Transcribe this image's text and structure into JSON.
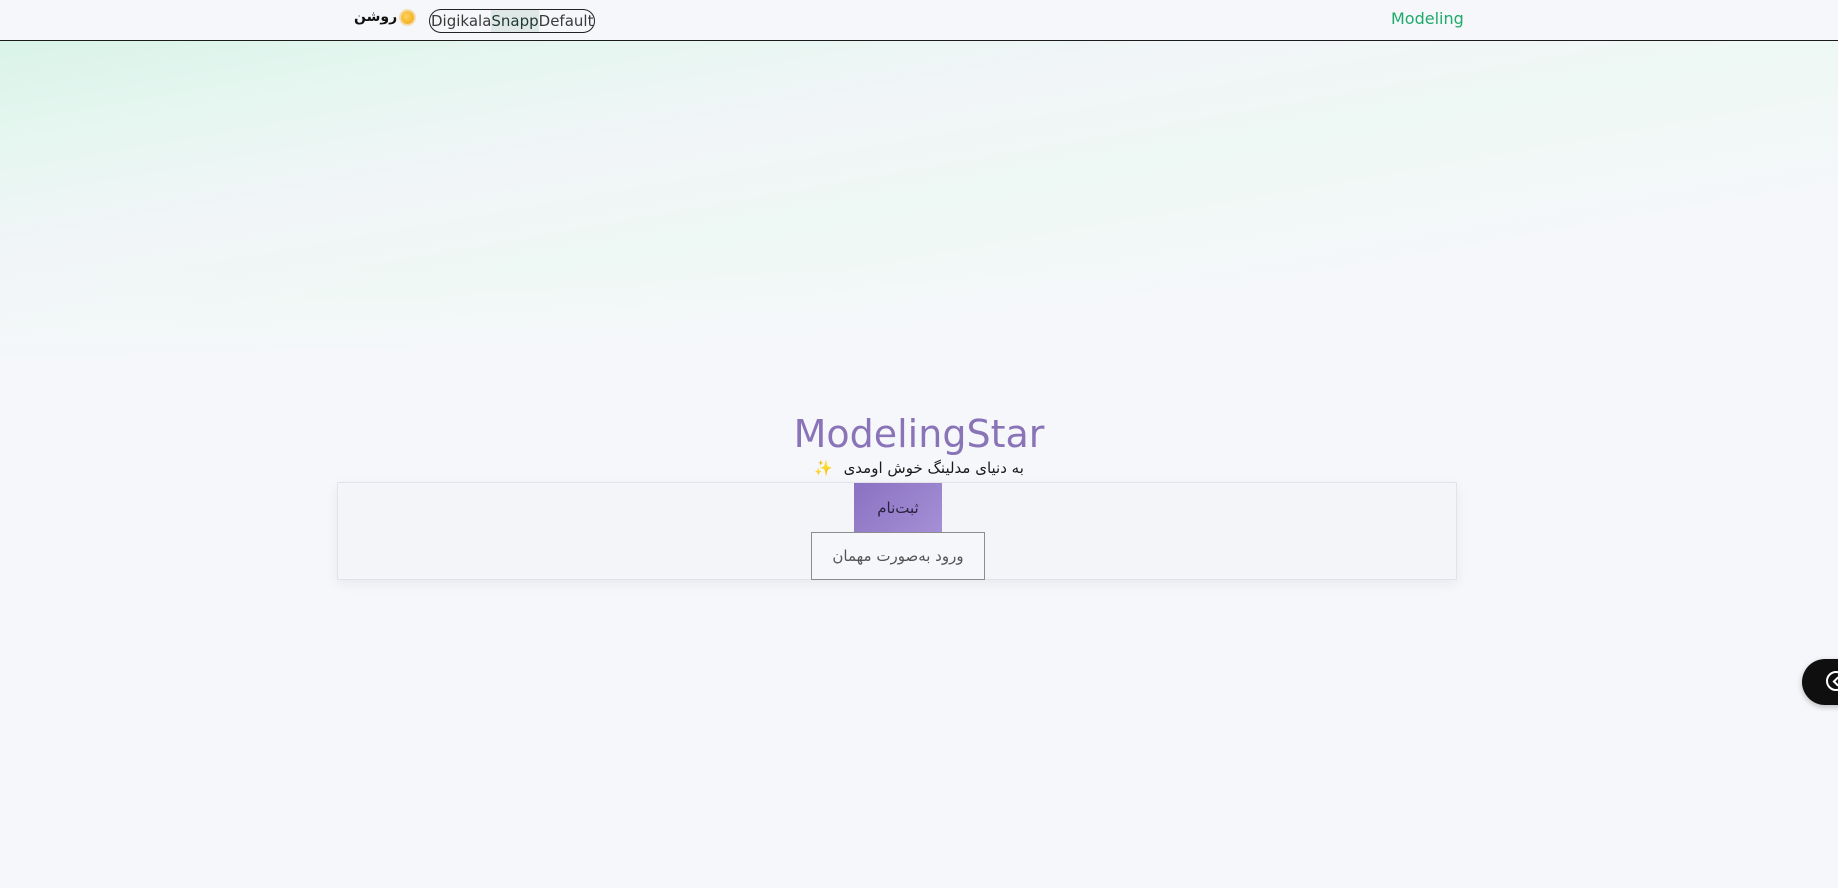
{
  "header": {
    "brand": "Modeling",
    "theme_switch": {
      "options": [
        "Digikala",
        "Snapp",
        "Default"
      ],
      "selected": "Snapp"
    },
    "light_toggle_label": "روشن",
    "light_toggle_icon": "sun-icon"
  },
  "hero": {
    "title": "ModelingStar",
    "subtitle": "به دنیای مدلینگ خوش اومدی",
    "subtitle_icon": "sparkle-icon"
  },
  "actions": {
    "signup_label": "ثبت‌نام",
    "guest_label": "ورود به‌صورت مهمان"
  },
  "side_handle": {
    "icon": "chevron-left-icon"
  },
  "colors": {
    "brand": "#1faa6a",
    "title": "#8a74b8",
    "signup_bg": "#8b72c2",
    "header_border": "#1b1b1b"
  }
}
